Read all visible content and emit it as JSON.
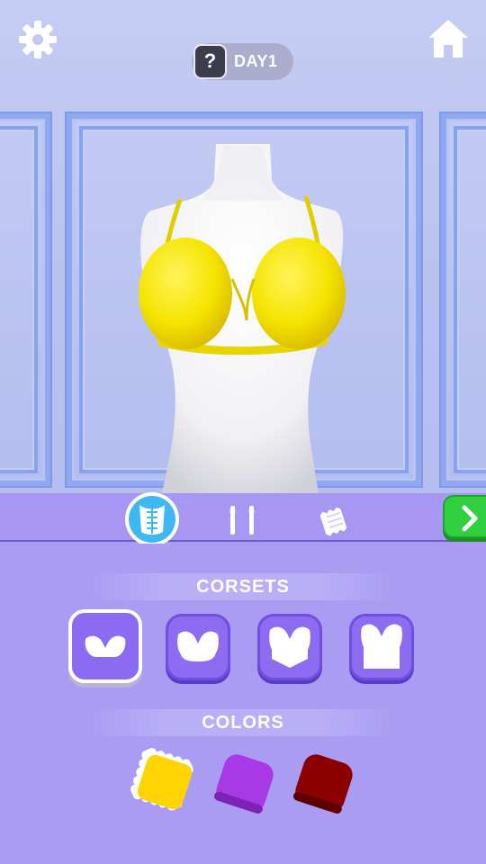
{
  "header": {
    "help_label": "?",
    "day_label": "DAY1"
  },
  "icons": {
    "settings": "gear-icon",
    "home": "home-icon",
    "next": "chevron-right-icon",
    "tab_corsets": "corset-icon",
    "tab_straps": "straps-icon",
    "tab_fabric": "fabric-icon"
  },
  "tabs": [
    {
      "id": "corsets",
      "selected": true
    },
    {
      "id": "straps",
      "selected": false
    },
    {
      "id": "fabric",
      "selected": false
    }
  ],
  "sections": {
    "corsets_title": "CORSETS",
    "colors_title": "COLORS"
  },
  "corset_options": [
    {
      "style": "bra-only",
      "selected": true
    },
    {
      "style": "short-corset",
      "selected": false
    },
    {
      "style": "v-corset",
      "selected": false
    },
    {
      "style": "full-corset",
      "selected": false
    }
  ],
  "color_options": [
    {
      "color": "#ffd400",
      "selected": true
    },
    {
      "color": "#a83ae6",
      "selected": false
    },
    {
      "color": "#8c0000",
      "selected": false
    }
  ],
  "colors": {
    "accent_purple": "#a99cf2",
    "next_green": "#2fcf3f",
    "current_garment": "#f5e400"
  }
}
